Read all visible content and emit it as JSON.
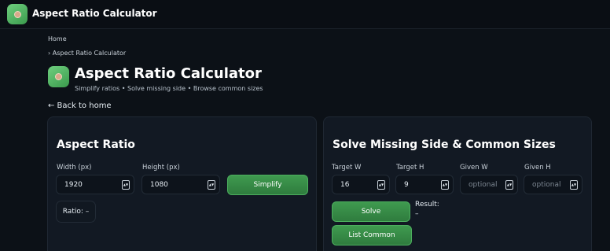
{
  "app": {
    "title": "Aspect Ratio Calculator"
  },
  "breadcrumb": {
    "home": "Home",
    "current": "› Aspect Ratio Calculator"
  },
  "page": {
    "title": "Aspect Ratio Calculator",
    "subtitle": "Simplify ratios • Solve missing side • Browse common sizes",
    "back_link": "← Back to home"
  },
  "aspect_card": {
    "title": "Aspect Ratio",
    "width_label": "Width (px)",
    "width_value": "1920",
    "height_label": "Height (px)",
    "height_value": "1080",
    "simplify_label": "Simplify",
    "ratio_text": "Ratio: –"
  },
  "solve_card": {
    "title": "Solve Missing Side & Common Sizes",
    "target_w_label": "Target W",
    "target_w_value": "16",
    "target_h_label": "Target H",
    "target_h_value": "9",
    "given_w_label": "Given W",
    "given_w_placeholder": "optional",
    "given_h_label": "Given H",
    "given_h_placeholder": "optional",
    "solve_label": "Solve",
    "list_common_label": "List Common",
    "result_label": "Result:",
    "result_value": "–"
  },
  "icons": {
    "logo": "app-logo-icon",
    "spinner": "number-spinner-icon"
  },
  "colors": {
    "background": "#0c1117",
    "card": "#121923",
    "accent": "#3f9a4f"
  }
}
